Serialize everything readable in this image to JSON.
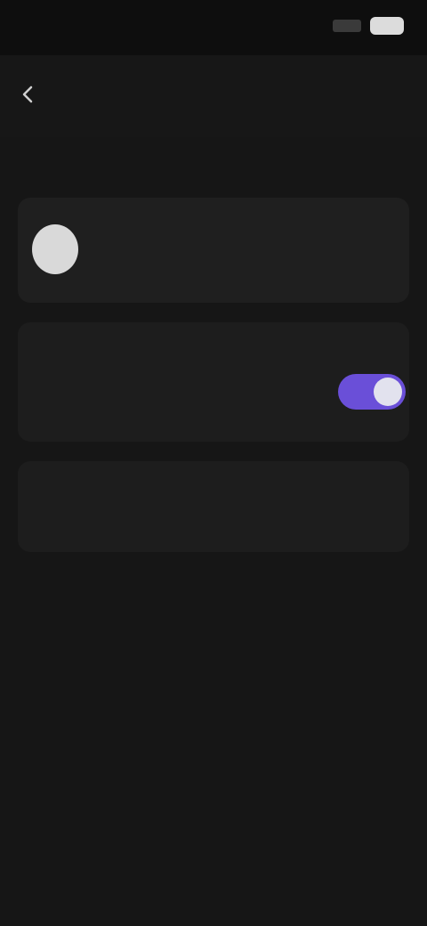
{
  "status_bar": {
    "time": "",
    "signal_icon": "signal-icon",
    "battery_icon": "battery-icon"
  },
  "header": {
    "back_icon": "chevron-left-icon",
    "title": ""
  },
  "section": {
    "label": ""
  },
  "account": {
    "avatar_icon": "avatar",
    "name": "",
    "subtitle": ""
  },
  "toggle_setting": {
    "overline": "",
    "title": "",
    "description": "",
    "enabled": true,
    "accent_color": "#6a4fd8"
  },
  "danger_action": {
    "title": "",
    "description": "",
    "color": "#b3363d"
  }
}
